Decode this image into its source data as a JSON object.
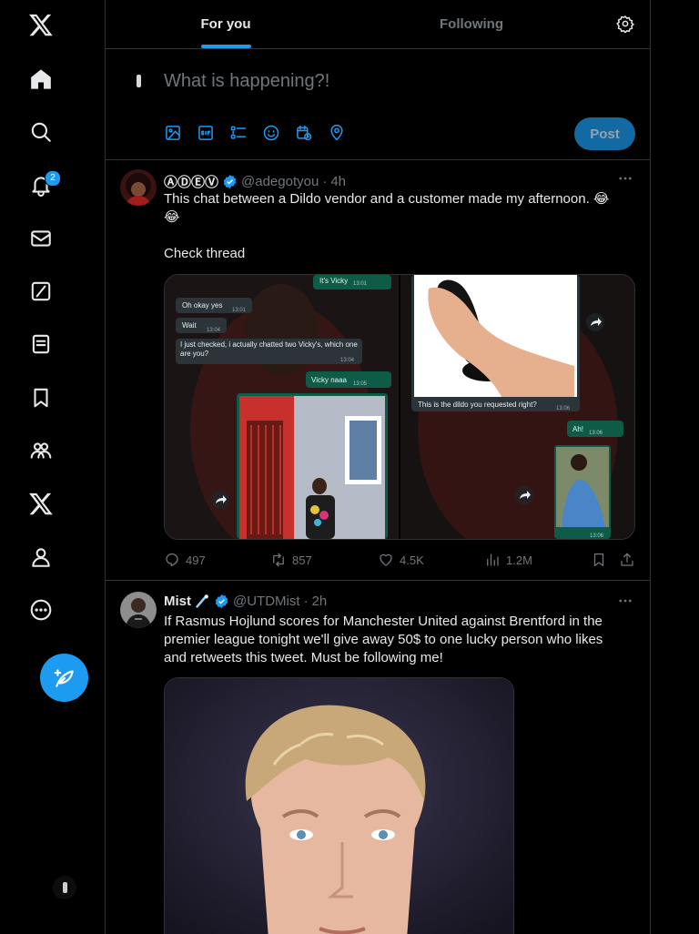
{
  "nav": {
    "badge_count": "2",
    "items": [
      {
        "icon": "x-logo-icon"
      },
      {
        "icon": "home-icon"
      },
      {
        "icon": "search-icon"
      },
      {
        "icon": "bell-icon"
      },
      {
        "icon": "mail-icon"
      },
      {
        "icon": "grok-icon"
      },
      {
        "icon": "lists-icon"
      },
      {
        "icon": "bookmark-icon"
      },
      {
        "icon": "communities-icon"
      },
      {
        "icon": "premium-x-icon"
      },
      {
        "icon": "profile-icon"
      },
      {
        "icon": "more-circle-icon"
      }
    ],
    "accent": "#1d9bf0"
  },
  "tabs": {
    "for_you": "For you",
    "following": "Following"
  },
  "composer": {
    "placeholder": "What is happening?!",
    "post_label": "Post"
  },
  "tweets": [
    {
      "name": "ⒶⒹⒺⓋ",
      "handle": "@adegotyou",
      "dot": "·",
      "time": "4h",
      "text_line1": "This chat between a Dildo vendor and a customer made my afternoon. 😂",
      "text_line2": "😂",
      "text_line3": "Check thread",
      "chat": {
        "b1": "It's Vicky",
        "b1_time": "13:01",
        "b2": "Oh okay yes",
        "b2_time": "13:01",
        "b3": "Wait",
        "b3_time": "13:04",
        "b4": "I just checked, i actually chatted two Vicky's, which one are you?",
        "b4_time": "13:04",
        "b5": "Vicky naaa",
        "b5_time": "13:05",
        "b6": "This is the dildo you requested right?",
        "b6_time": "13:06",
        "b7": "Ah!",
        "b7_time": "13:06",
        "b8_time": "13:06"
      },
      "replies": "497",
      "retweets": "857",
      "likes": "4.5K",
      "views": "1.2M"
    },
    {
      "name": "Mist",
      "handle": "@UTDMist",
      "dot": "·",
      "time": "2h",
      "text": "If Rasmus Hojlund scores for Manchester United against Brentford in the premier league tonight we'll give away 50$ to one lucky person who likes and retweets this tweet. Must be following me!"
    }
  ]
}
